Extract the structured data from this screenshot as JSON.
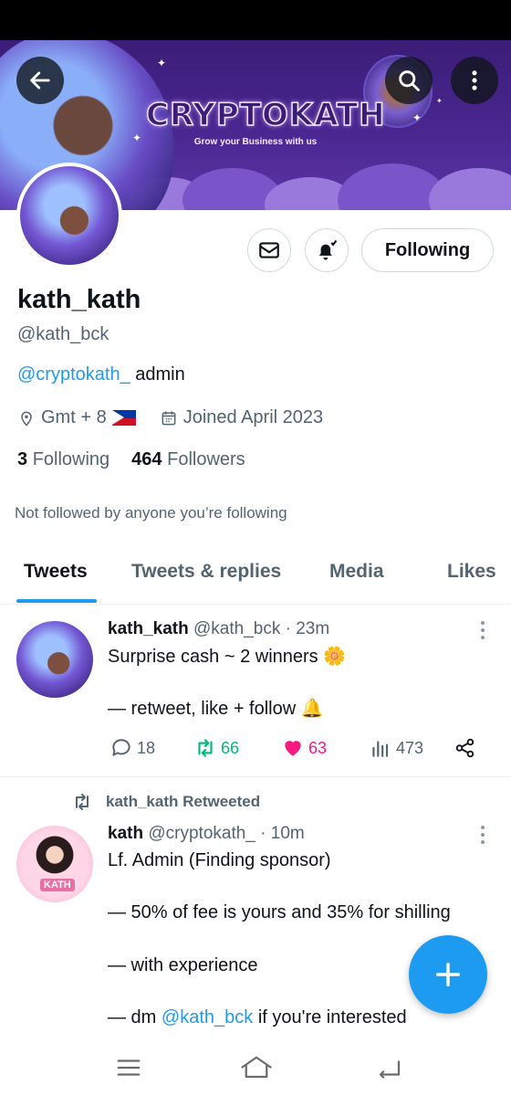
{
  "banner": {
    "brand": "CRYPTOKATH",
    "tagline": "Grow your Business with us"
  },
  "header": {
    "back_icon": "arrow-left-icon",
    "search_icon": "search-icon",
    "more_icon": "more-vertical-icon"
  },
  "profile": {
    "display_name": "kath_kath",
    "handle": "@kath_bck",
    "bio_mention": "@cryptokath_",
    "bio_rest": " admin",
    "location": "Gmt + 8",
    "joined": "Joined April 2023",
    "following_count": "3",
    "following_label": "Following",
    "followers_count": "464",
    "followers_label": "Followers",
    "not_followed": "Not followed by anyone you’re following",
    "following_button": "Following"
  },
  "tabs": [
    "Tweets",
    "Tweets & replies",
    "Media",
    "Likes"
  ],
  "tweets": [
    {
      "name": "kath_kath",
      "handle": "@kath_bck",
      "time": "· 23m",
      "line1": "Surprise cash ~ 2 winners 🌼",
      "line2": "— retweet, like + follow 🔔",
      "replies": "18",
      "retweets": "66",
      "likes": "63",
      "views": "473"
    },
    {
      "retweeted_by": "kath_kath Retweeted",
      "name": "kath",
      "handle": "@cryptokath_",
      "time": "· 10m",
      "line1": "Lf. Admin (Finding sponsor)",
      "line2": "— 50% of fee is yours and 35% for shilling",
      "line3": "— with experience",
      "line4_pre": "— dm ",
      "line4_mention": "@kath_bck",
      "line4_post": " if you're interested",
      "avatar_text": "KATH"
    }
  ],
  "colors": {
    "accent": "#1d9bf0",
    "retweet": "#00ba7c",
    "like": "#f91880",
    "banner": "#3b1d78"
  }
}
